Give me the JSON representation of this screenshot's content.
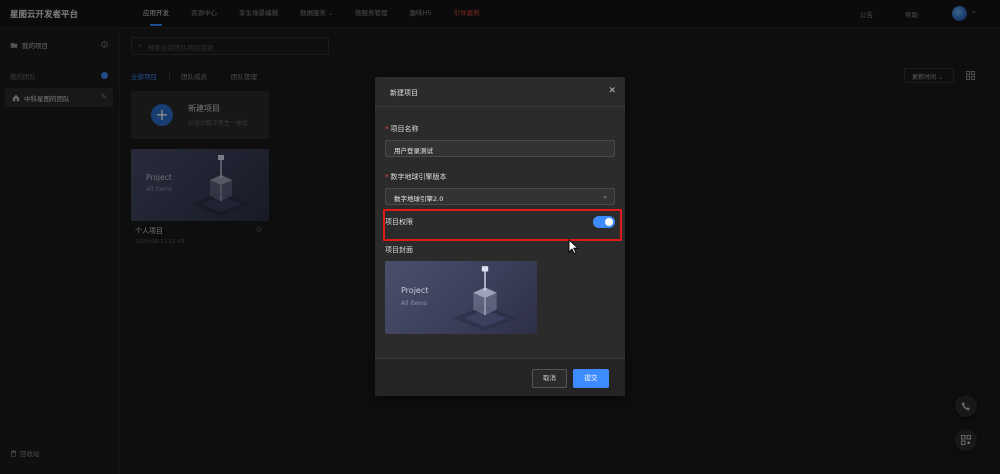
{
  "app": {
    "title": "星图云开发者平台"
  },
  "nav": {
    "items": [
      {
        "label": "应用开发",
        "active": true
      },
      {
        "label": "资源中心"
      },
      {
        "label": "孪生场景编辑"
      },
      {
        "label": "数据服务",
        "dropdown": true
      },
      {
        "label": "微服务管理"
      },
      {
        "label": "趣味H5"
      },
      {
        "label": "引导案例",
        "accent": "#d9443a"
      }
    ],
    "right": {
      "notice": "公告",
      "help": "帮助"
    }
  },
  "sidebar": {
    "my_projects": "我的项目",
    "my_teams_section": "我的团队",
    "team_name": "中科星图的团队",
    "recycle_bin": "回收站"
  },
  "main": {
    "search_placeholder": "搜索当前团队项目资源",
    "tabs": [
      {
        "label": "全部项目",
        "active": true
      },
      {
        "label": "团队成员"
      },
      {
        "label": "团队管理"
      }
    ],
    "sort_label": "更新时间",
    "new_card": {
      "title": "新建项目",
      "subtitle": "从设计数字孪生一体化"
    },
    "project": {
      "cover_title": "Project",
      "cover_sub": "All items",
      "name": "个人项目",
      "date": "2025-06-12 15:43"
    }
  },
  "modal": {
    "title": "新建项目",
    "name_label": "项目名称",
    "name_value": "用户登录测试",
    "engine_label": "数字地球引擎版本",
    "engine_value": "数字地球引擎2.0",
    "permission_label": "项目权限",
    "permission_on": true,
    "cover_label": "项目封面",
    "cover_title": "Project",
    "cover_sub": "All items",
    "cancel": "取消",
    "submit": "提交"
  },
  "colors": {
    "accent": "#3d8bff",
    "highlight": "#e01a1a",
    "required": "#e5493f"
  },
  "icons": [
    "folder-icon",
    "info-icon",
    "gear-icon",
    "team-icon",
    "edit-icon",
    "trash-icon",
    "search-icon",
    "grid-icon",
    "plus-icon",
    "star-icon",
    "close-icon",
    "chevron-down-icon",
    "phone-icon",
    "qrcode-icon",
    "cursor-icon"
  ]
}
